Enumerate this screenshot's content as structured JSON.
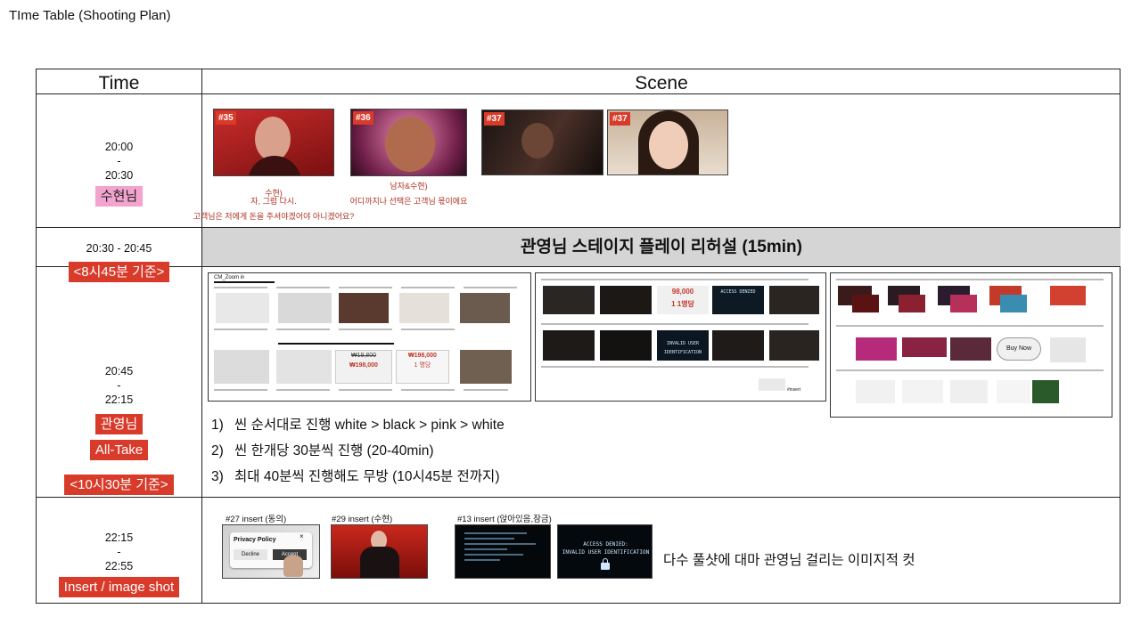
{
  "page_title": "TIme Table (Shooting Plan)",
  "headers": {
    "time": "Time",
    "scene": "Scene"
  },
  "rows": [
    {
      "time_start": "20:00",
      "time_sep": "-",
      "time_end": "20:30",
      "tag": "수현님",
      "thumbs": [
        "#35",
        "#36",
        "#37",
        "#37"
      ],
      "captions": {
        "c35_name": "수현)",
        "c35_line1": "자, 그럼 다시.",
        "c35_line2": "고객님은 저에게 돈을 주셔야겠어야 아니겠어요?",
        "c36_name": "남자&수현)",
        "c36_line1": "어디까지나 선택은 고객님 몫이에요"
      }
    },
    {
      "time": "20:30 - 20:45",
      "banner": "관영님 스테이지 플레이 리허설 (15min)"
    },
    {
      "tag_top": "<8시45분 기준>",
      "time_start": "20:45",
      "time_sep": "-",
      "time_end": "22:15",
      "tag_name": "관영님",
      "tag_mode": "All-Take",
      "tag_bottom": "<10시30분 기준>",
      "board_texts": {
        "cm_zoom": "CM_Zoom in",
        "price_old": "₩198,000",
        "price_new": "₩198,000",
        "price_crossed": "₩19,800",
        "discount": "1 명당",
        "price_frag": "98,000",
        "discount_frag": "1 1명당",
        "access": "ACCESS DENIED",
        "invalid": "INVALID USER IDENTIFICATION",
        "buy_now": "Buy Now",
        "insert": "#insert"
      },
      "notes": [
        {
          "num": "1)",
          "text": "씬 순서대로 진행 white > black > pink > white"
        },
        {
          "num": "2)",
          "text": "씬 한개당 30분씩 진행 (20-40min)"
        },
        {
          "num": "3)",
          "text": "최대 40분씩 진행해도 무방 (10시45분 전까지)"
        }
      ]
    },
    {
      "time_start": "22:15",
      "time_sep": "-",
      "time_end": "22:55",
      "tag": "Insert / image shot",
      "inserts": [
        {
          "label": "#27 insert (동의)",
          "policy_title": "Privacy Policy",
          "decline": "Decline",
          "accept": "Accept",
          "close": "×"
        },
        {
          "label": "#29 insert (수현)"
        },
        {
          "label": "#13 insert (앉아있음,잠금)",
          "access_denied": "ACCESS DENIED:",
          "invalid_user": "INVALID USER IDENTIFICATION"
        }
      ],
      "description": "다수 풀샷에 대마 관영님 걸리는 이미지적 컷"
    }
  ],
  "colors": {
    "tag_red": "#d93b2b",
    "tag_pink": "#f2a4cf",
    "banner_gray": "#d5d5d5",
    "caption_red": "#b03020"
  }
}
